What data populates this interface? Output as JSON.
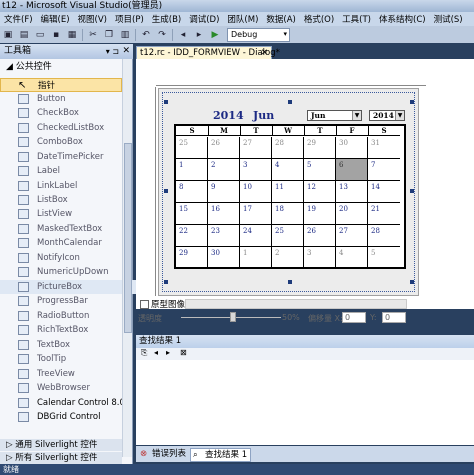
{
  "window": {
    "title": "t12 - Microsoft Visual Studio(管理员)"
  },
  "menu": [
    "文件(F)",
    "编辑(E)",
    "视图(V)",
    "项目(P)",
    "生成(B)",
    "调试(D)",
    "团队(M)",
    "数据(A)",
    "格式(O)",
    "工具(T)",
    "体系结构(C)",
    "测试(S)"
  ],
  "toolbar": {
    "configuration": "Debug"
  },
  "toolbox": {
    "title": "工具箱",
    "group": "公共控件",
    "items": [
      "指针",
      "Button",
      "CheckBox",
      "CheckedListBox",
      "ComboBox",
      "DateTimePicker",
      "Label",
      "LinkLabel",
      "ListBox",
      "ListView",
      "MaskedTextBox",
      "MonthCalendar",
      "NotifyIcon",
      "NumericUpDown",
      "PictureBox",
      "ProgressBar",
      "RadioButton",
      "RichTextBox",
      "TextBox",
      "ToolTip",
      "TreeView",
      "WebBrowser",
      "Calendar Control 8.0",
      "DBGrid  Control"
    ],
    "group2": "通用 Silverlight 控件",
    "group3": "所有 Silverlight 控件"
  },
  "document_tab": {
    "label": "t12.rc - IDD_FORMVIEW - Dialog*"
  },
  "calendar": {
    "year": "2014",
    "month": "Jun",
    "month_combo": "Jun",
    "year_combo": "2014",
    "weekdays": [
      "S",
      "M",
      "T",
      "W",
      "T",
      "F",
      "S"
    ],
    "weeks": [
      [
        "25",
        "26",
        "27",
        "28",
        "29",
        "30",
        "31"
      ],
      [
        "1",
        "2",
        "3",
        "4",
        "5",
        "6",
        "7"
      ],
      [
        "8",
        "9",
        "10",
        "11",
        "12",
        "13",
        "14"
      ],
      [
        "15",
        "16",
        "17",
        "18",
        "19",
        "20",
        "21"
      ],
      [
        "22",
        "23",
        "24",
        "25",
        "26",
        "27",
        "28"
      ],
      [
        "29",
        "30",
        "1",
        "2",
        "3",
        "4",
        "5"
      ]
    ]
  },
  "picture_strip": {
    "checkbox_label": "原型图像:"
  },
  "zoom_row": {
    "transparency_label": "透明度",
    "zoom_value": "50%",
    "offset_x_label": "偏移量 X:",
    "offset_x_value": "0",
    "offset_y_label": "Y:",
    "offset_y_value": "0"
  },
  "find_panel": {
    "title": "查找结果 1"
  },
  "bottom_tabs": [
    "错误列表",
    "查找结果 1"
  ],
  "status": {
    "text": "就绪"
  }
}
